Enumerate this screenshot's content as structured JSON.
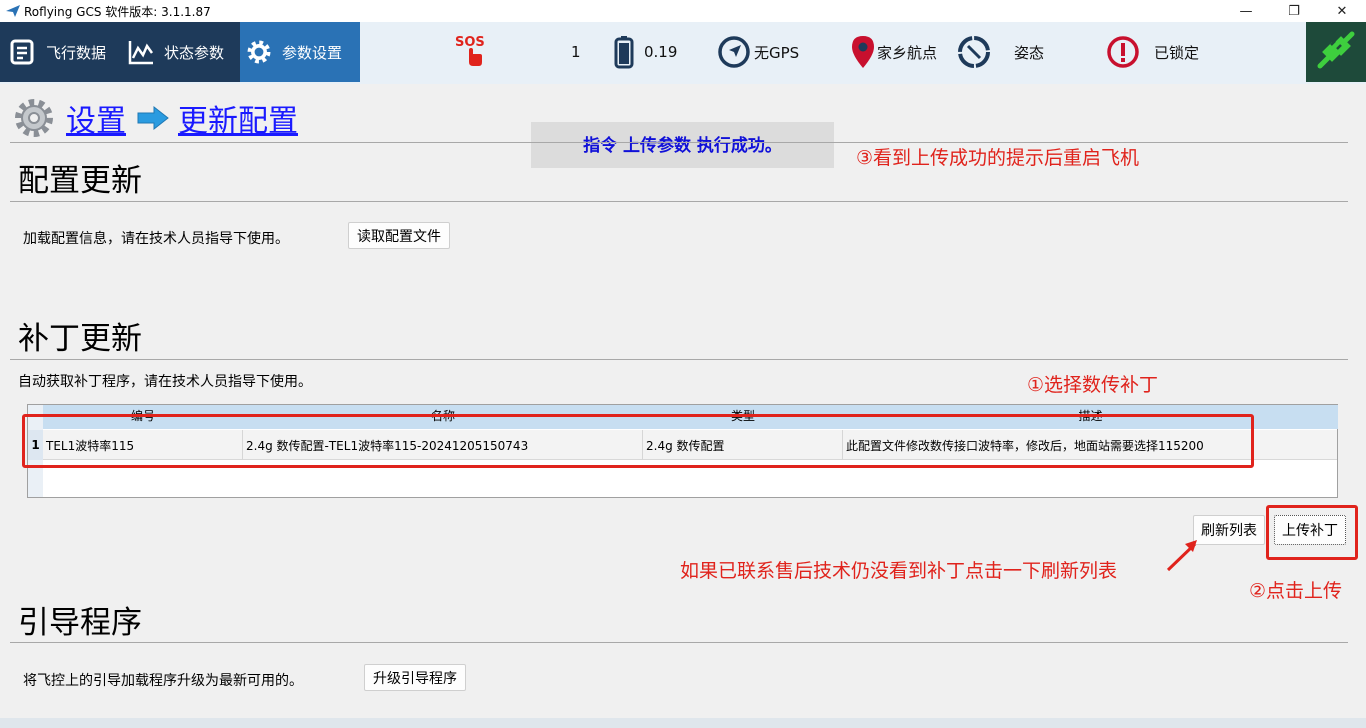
{
  "window": {
    "title": "Roflying GCS 软件版本: 3.1.1.87",
    "minimize": "—",
    "restore": "❐",
    "close": "✕"
  },
  "toolbar": {
    "nav": [
      {
        "label": "飞行数据",
        "icon": "flight-data-icon",
        "active": false
      },
      {
        "label": "状态参数",
        "icon": "chart-line-icon",
        "active": false
      },
      {
        "label": "参数设置",
        "icon": "gear-icon",
        "active": true
      }
    ],
    "sos_icon": "sos-icon",
    "satellite_count": "1",
    "battery": "0.19",
    "gps": "无GPS",
    "home": "家乡航点",
    "attitude": "姿态",
    "lock": "已锁定",
    "connect_icon": "plug-icon"
  },
  "breadcrumb": {
    "root": "设置",
    "current": "更新配置"
  },
  "toast": "指令 上传参数 执行成功。",
  "annotations": {
    "step3": "③看到上传成功的提示后重启飞机",
    "step1": "①选择数传补丁",
    "refresh_hint": "如果已联系售后技术仍没看到补丁点击一下刷新列表",
    "step2": "②点击上传"
  },
  "config_update": {
    "title": "配置更新",
    "desc": "加载配置信息，请在技术人员指导下使用。",
    "button": "读取配置文件"
  },
  "patch_update": {
    "title": "补丁更新",
    "desc": "自动获取补丁程序，请在技术人员指导下使用。",
    "columns": [
      "编号",
      "名称",
      "类型",
      "描述"
    ],
    "rows": [
      {
        "index": "1",
        "id": "TEL1波特率115",
        "name": "2.4g 数传配置-TEL1波特率115-20241205150743",
        "type": "2.4g 数传配置",
        "description": "此配置文件修改数传接口波特率，修改后，地面站需要选择115200"
      }
    ],
    "refresh_button": "刷新列表",
    "upload_button": "上传补丁"
  },
  "bootloader": {
    "title": "引导程序",
    "desc": "将飞控上的引导加载程序升级为最新可用的。",
    "button": "升级引导程序"
  },
  "colors": {
    "toolbar_bg": "#e8f0f7",
    "nav_bg": "#1e3a5a",
    "nav_active_bg": "#2a72b5",
    "link": "#1a1aff",
    "annotation": "#e0231c",
    "toast_text": "#1010d8",
    "table_header": "#c7def1"
  }
}
